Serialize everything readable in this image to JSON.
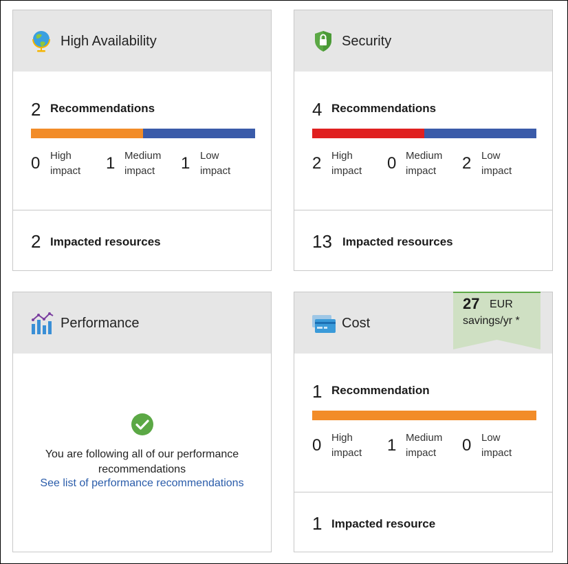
{
  "colors": {
    "high": "#e02020",
    "medium": "#f28c28",
    "low": "#3a5ba9",
    "header_bg": "#e6e6e6",
    "savings_bg": "#cfe0c3",
    "check": "#5ba845",
    "link": "#2a5caa"
  },
  "cards": {
    "high_availability": {
      "title": "High Availability",
      "icon": "globe-icon",
      "recommendations_count": "2",
      "recommendations_label": "Recommendations",
      "bar": [
        {
          "impact": "medium",
          "fraction": 0.5
        },
        {
          "impact": "low",
          "fraction": 0.5
        }
      ],
      "impacts": {
        "high": {
          "count": "0",
          "label1": "High",
          "label2": "impact"
        },
        "medium": {
          "count": "1",
          "label1": "Medium",
          "label2": "impact"
        },
        "low": {
          "count": "1",
          "label1": "Low",
          "label2": "impact"
        }
      },
      "resources_count": "2",
      "resources_label": "Impacted resources"
    },
    "security": {
      "title": "Security",
      "icon": "shield-lock-icon",
      "recommendations_count": "4",
      "recommendations_label": "Recommendations",
      "bar": [
        {
          "impact": "high",
          "fraction": 0.5
        },
        {
          "impact": "low",
          "fraction": 0.5
        }
      ],
      "impacts": {
        "high": {
          "count": "2",
          "label1": "High",
          "label2": "impact"
        },
        "medium": {
          "count": "0",
          "label1": "Medium",
          "label2": "impact"
        },
        "low": {
          "count": "2",
          "label1": "Low",
          "label2": "impact"
        }
      },
      "resources_count": "13",
      "resources_label": "Impacted resources"
    },
    "performance": {
      "title": "Performance",
      "icon": "bar-chart-icon",
      "status_icon": "checkmark-circle-icon",
      "message": "You are following all of our performance recommendations",
      "link": "See list of performance recommendations"
    },
    "cost": {
      "title": "Cost",
      "icon": "credit-card-icon",
      "savings_amount": "27",
      "savings_currency": "EUR",
      "savings_period": "savings/yr *",
      "recommendations_count": "1",
      "recommendations_label": "Recommendation",
      "bar": [
        {
          "impact": "medium",
          "fraction": 1.0
        }
      ],
      "impacts": {
        "high": {
          "count": "0",
          "label1": "High",
          "label2": "impact"
        },
        "medium": {
          "count": "1",
          "label1": "Medium",
          "label2": "impact"
        },
        "low": {
          "count": "0",
          "label1": "Low",
          "label2": "impact"
        }
      },
      "resources_count": "1",
      "resources_label": "Impacted resource"
    }
  }
}
